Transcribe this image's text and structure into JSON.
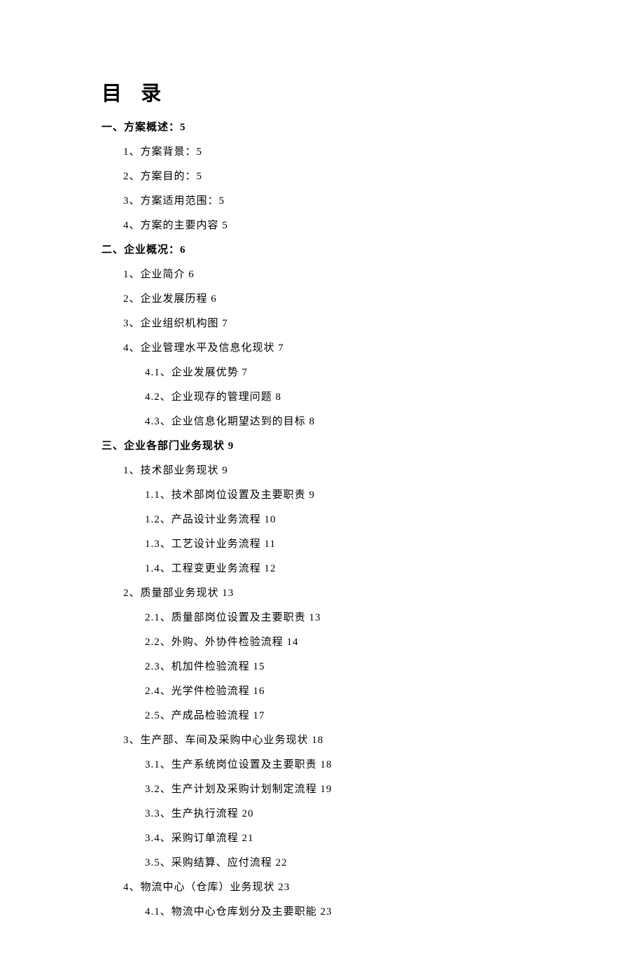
{
  "title": "目 录",
  "toc": [
    {
      "level": 1,
      "text": "一、方案概述：5"
    },
    {
      "level": 2,
      "text": "1、方案背景：5"
    },
    {
      "level": 2,
      "text": "2、方案目的：5"
    },
    {
      "level": 2,
      "text": "3、方案适用范围：5"
    },
    {
      "level": 2,
      "text": "4、方案的主要内容 5"
    },
    {
      "level": 1,
      "text": "二、企业概况：6"
    },
    {
      "level": 2,
      "text": "1、企业简介 6"
    },
    {
      "level": 2,
      "text": "2、企业发展历程 6"
    },
    {
      "level": 2,
      "text": "3、企业组织机构图 7"
    },
    {
      "level": 2,
      "text": "4、企业管理水平及信息化现状 7"
    },
    {
      "level": 3,
      "text": "4.1、企业发展优势 7"
    },
    {
      "level": 3,
      "text": "4.2、企业现存的管理问题 8"
    },
    {
      "level": 3,
      "text": "4.3、企业信息化期望达到的目标 8"
    },
    {
      "level": 1,
      "text": "三、企业各部门业务现状 9"
    },
    {
      "level": 2,
      "text": "1、技术部业务现状 9"
    },
    {
      "level": 3,
      "text": "1.1、技术部岗位设置及主要职责 9"
    },
    {
      "level": 3,
      "text": "1.2、产品设计业务流程 10"
    },
    {
      "level": 3,
      "text": "1.3、工艺设计业务流程 11"
    },
    {
      "level": 3,
      "text": "1.4、工程变更业务流程 12"
    },
    {
      "level": 2,
      "text": "2、质量部业务现状 13"
    },
    {
      "level": 3,
      "text": "2.1、质量部岗位设置及主要职责 13"
    },
    {
      "level": 3,
      "text": "2.2、外购、外协件检验流程 14"
    },
    {
      "level": 3,
      "text": "2.3、机加件检验流程 15"
    },
    {
      "level": 3,
      "text": "2.4、光学件检验流程 16"
    },
    {
      "level": 3,
      "text": "2.5、产成品检验流程 17"
    },
    {
      "level": 2,
      "text": "3、生产部、车间及采购中心业务现状 18"
    },
    {
      "level": 3,
      "text": "3.1、生产系统岗位设置及主要职责 18"
    },
    {
      "level": 3,
      "text": "3.2、生产计划及采购计划制定流程 19"
    },
    {
      "level": 3,
      "text": "3.3、生产执行流程 20"
    },
    {
      "level": 3,
      "text": "3.4、采购订单流程 21"
    },
    {
      "level": 3,
      "text": "3.5、采购结算、应付流程 22"
    },
    {
      "level": 2,
      "text": "4、物流中心（仓库）业务现状 23"
    },
    {
      "level": 3,
      "text": "4.1、物流中心仓库划分及主要职能 23"
    }
  ]
}
